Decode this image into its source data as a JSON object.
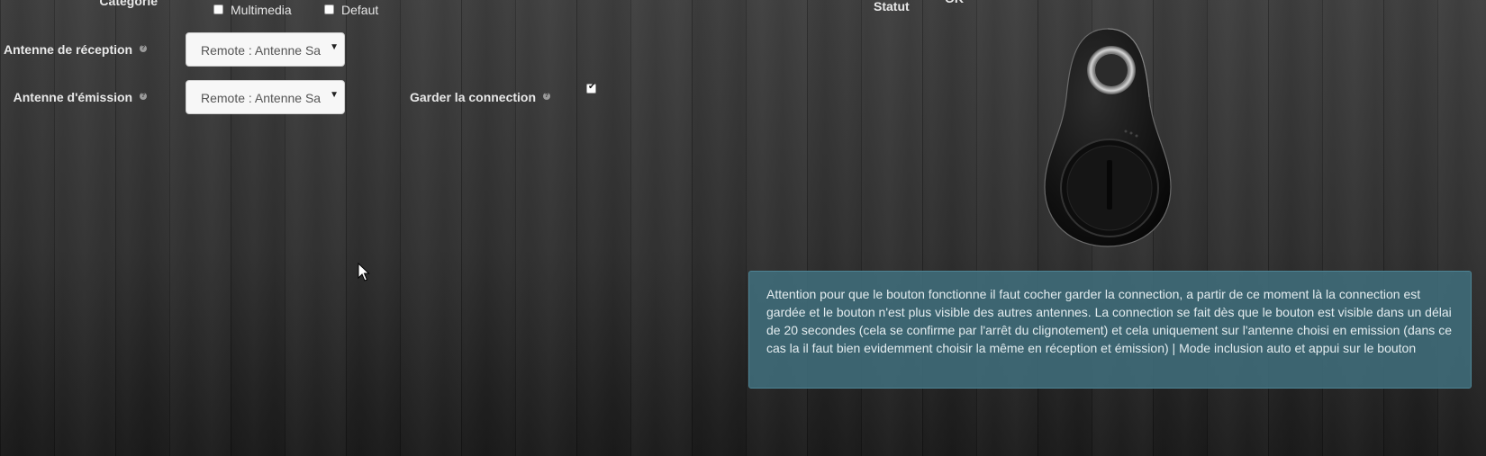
{
  "form": {
    "categorie": {
      "label": "Catégorie",
      "options": [
        {
          "label": "Multimedia",
          "checked": false
        },
        {
          "label": "Defaut",
          "checked": false
        }
      ]
    },
    "antenne_reception": {
      "label": "Antenne de réception",
      "value": "Remote : Antenne Sa"
    },
    "antenne_emission": {
      "label": "Antenne d'émission",
      "value": "Remote : Antenne Sa"
    },
    "garder_connection": {
      "label": "Garder la connection",
      "checked": true
    },
    "statut": {
      "label": "Statut",
      "value": "OK"
    }
  },
  "help_glyph": "?",
  "device_image": {
    "icon": "bluetooth-tracker-tag-image"
  },
  "alert": {
    "text": "Attention pour que le bouton fonctionne il faut cocher garder la connection, a partir de ce moment là la connection est gardée et le bouton n'est plus visible des autres antennes. La connection se fait dès que le bouton est visible dans un délai de 20 secondes (cela se confirme par l'arrêt du clignotement) et cela uniquement sur l'antenne choisi en emission (dans ce cas la il faut bien evidemment choisir la même en réception et émission) | Mode inclusion auto et appui sur le bouton"
  },
  "colors": {
    "background": "#2b2b2b",
    "alert_bg": "#3f6c79",
    "label_text": "#e8e8e8"
  }
}
